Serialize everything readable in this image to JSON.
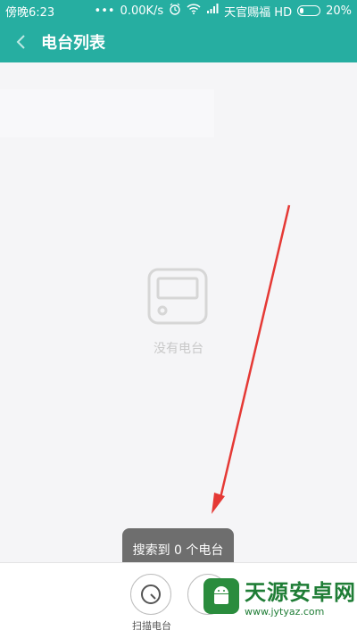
{
  "status_bar": {
    "time": "傍晚6:23",
    "dots": "•••",
    "speed": "0.00K/s",
    "carrier": "天官赐福 HD",
    "battery": "20%"
  },
  "app_bar": {
    "title": "电台列表"
  },
  "empty_state": {
    "text": "没有电台"
  },
  "toast": {
    "text": "搜索到 0 个电台"
  },
  "bottom": {
    "scan_label": "扫描电台"
  },
  "watermark": {
    "title": "天源安卓网",
    "url": "www.jytyaz.com"
  },
  "colors": {
    "accent": "#26aea1",
    "arrow": "#e53935"
  }
}
